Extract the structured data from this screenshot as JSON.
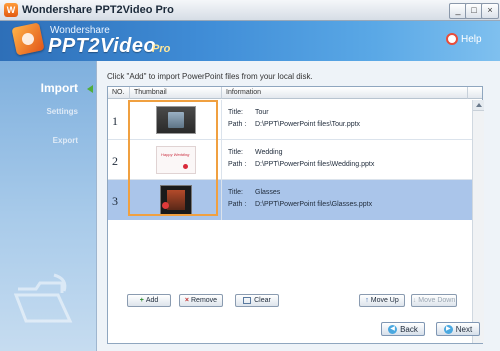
{
  "window": {
    "title": "Wondershare PPT2Video Pro",
    "min_glyph": "_",
    "max_glyph": "□",
    "close_glyph": "×"
  },
  "header": {
    "brand_small": "Wondershare",
    "brand_main": "PPT2Video",
    "brand_pro": "Pro",
    "help_label": "Help"
  },
  "sidebar": {
    "items": [
      {
        "label": "Import",
        "active": true
      },
      {
        "label": "Settings",
        "active": false
      },
      {
        "label": "Export",
        "active": false
      }
    ]
  },
  "main": {
    "instruction": "Click \"Add\" to import PowerPoint files from your local disk.",
    "columns": {
      "no": "NO.",
      "thumbnail": "Thumbnail",
      "information": "Information"
    },
    "title_key": "Title:",
    "path_key": "Path :",
    "rows": [
      {
        "no": "1",
        "title": "Tour",
        "path": "D:\\PPT\\PowerPoint files\\Tour.pptx",
        "thumb_icon": "tour-slide-thumbnail"
      },
      {
        "no": "2",
        "title": "Wedding",
        "path": "D:\\PPT\\PowerPoint files\\Wedding.pptx",
        "thumb_icon": "wedding-slide-thumbnail",
        "thumb_text": "Happy Wedding"
      },
      {
        "no": "3",
        "title": "Glasses",
        "path": "D:\\PPT\\PowerPoint files\\Glasses.pptx",
        "thumb_icon": "glasses-slide-thumbnail",
        "selected": true
      }
    ]
  },
  "toolbar": {
    "add_label": "Add",
    "remove_label": "Remove",
    "clear_label": "Clear",
    "move_up_label": "Move Up",
    "move_down_label": "Move Down"
  },
  "footer": {
    "back_label": "Back",
    "next_label": "Next"
  },
  "colors": {
    "header_blue": "#3f8cd6",
    "selection": "#aac5ea",
    "highlight_orange": "#f0a040",
    "sidebar_blue": "#7fb0de"
  }
}
